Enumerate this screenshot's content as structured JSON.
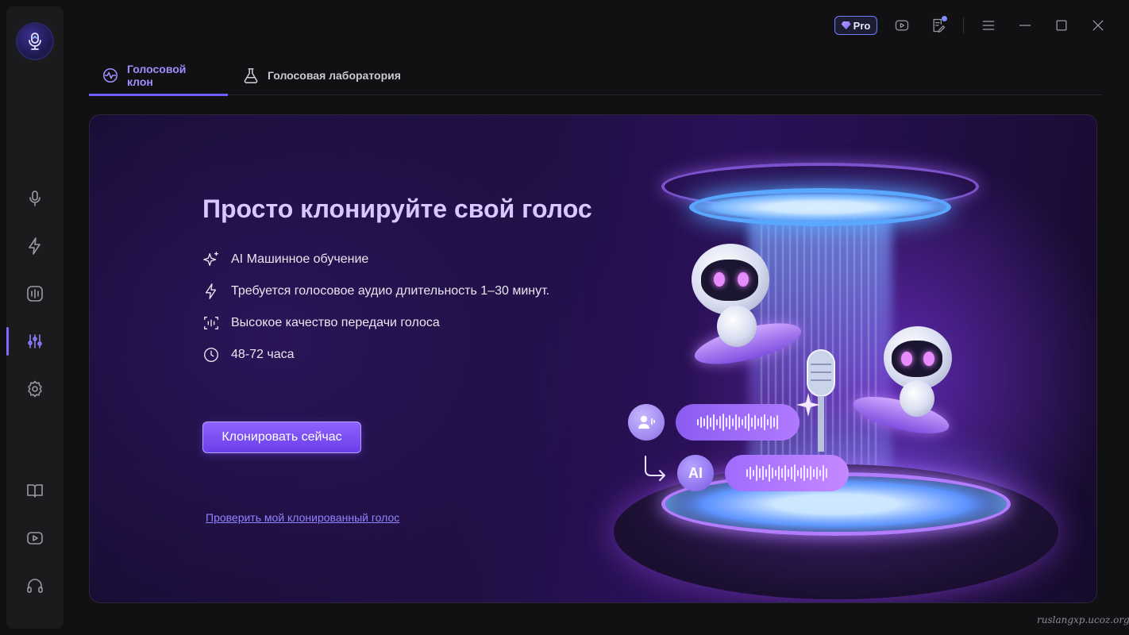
{
  "window": {
    "pro_label": "Pro"
  },
  "tabs": [
    {
      "label": "Голосовой клон",
      "active": true
    },
    {
      "label": "Голосовая лаборатория",
      "active": false
    }
  ],
  "sidebar": {
    "items": [
      {
        "icon": "microphone-icon"
      },
      {
        "icon": "lightning-icon"
      },
      {
        "icon": "voice-waveform-icon"
      },
      {
        "icon": "equalizer-icon",
        "active": true
      },
      {
        "icon": "gear-icon"
      },
      {
        "icon": "book-icon"
      },
      {
        "icon": "youtube-icon"
      },
      {
        "icon": "headset-icon"
      }
    ]
  },
  "hero": {
    "title": "Просто клонируйте свой голос",
    "features": [
      {
        "icon": "sparkle-icon",
        "text": "AI Машинное обучение"
      },
      {
        "icon": "lightning-icon",
        "text": "Требуется голосовое аудио длительность 1–30 минут."
      },
      {
        "icon": "voice-scan-icon",
        "text": "Высокое качество передачи голоса"
      },
      {
        "icon": "clock-icon",
        "text": "48-72 часа"
      }
    ],
    "cta_label": "Клонировать сейчас",
    "check_link": "Проверить мой клонированный голос",
    "ai_badge": "AI"
  },
  "watermark": "ruslangxp.ucoz.org",
  "colors": {
    "accent": "#7c6cff",
    "cta": "#7a4ff2",
    "link": "#8f84ff"
  }
}
